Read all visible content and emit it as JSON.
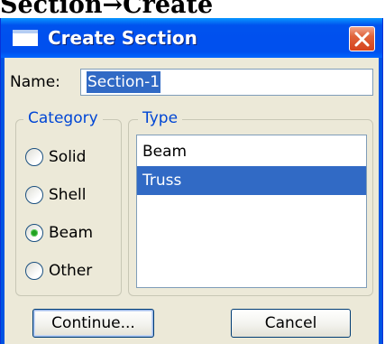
{
  "caption": "Section→Create",
  "dialog": {
    "title": "Create Section",
    "close_symbol": "×",
    "name_label": "Name:",
    "name_value": "Section-1",
    "category": {
      "legend": "Category",
      "options": [
        {
          "label": "Solid",
          "selected": false
        },
        {
          "label": "Shell",
          "selected": false
        },
        {
          "label": "Beam",
          "selected": true
        },
        {
          "label": "Other",
          "selected": false
        }
      ]
    },
    "type": {
      "legend": "Type",
      "items": [
        {
          "label": "Beam",
          "selected": false
        },
        {
          "label": "Truss",
          "selected": true
        }
      ]
    },
    "buttons": {
      "continue": "Continue...",
      "cancel": "Cancel"
    }
  },
  "colors": {
    "titlebar": "#0050ee",
    "selection": "#316ac5",
    "legend_text": "#0046d5",
    "dialog_face": "#ece9d8",
    "close_button": "#e0633a"
  },
  "icons": {
    "window_icon": "window-icon",
    "close_icon": "close-icon",
    "radio_icon": "radio-icon"
  }
}
